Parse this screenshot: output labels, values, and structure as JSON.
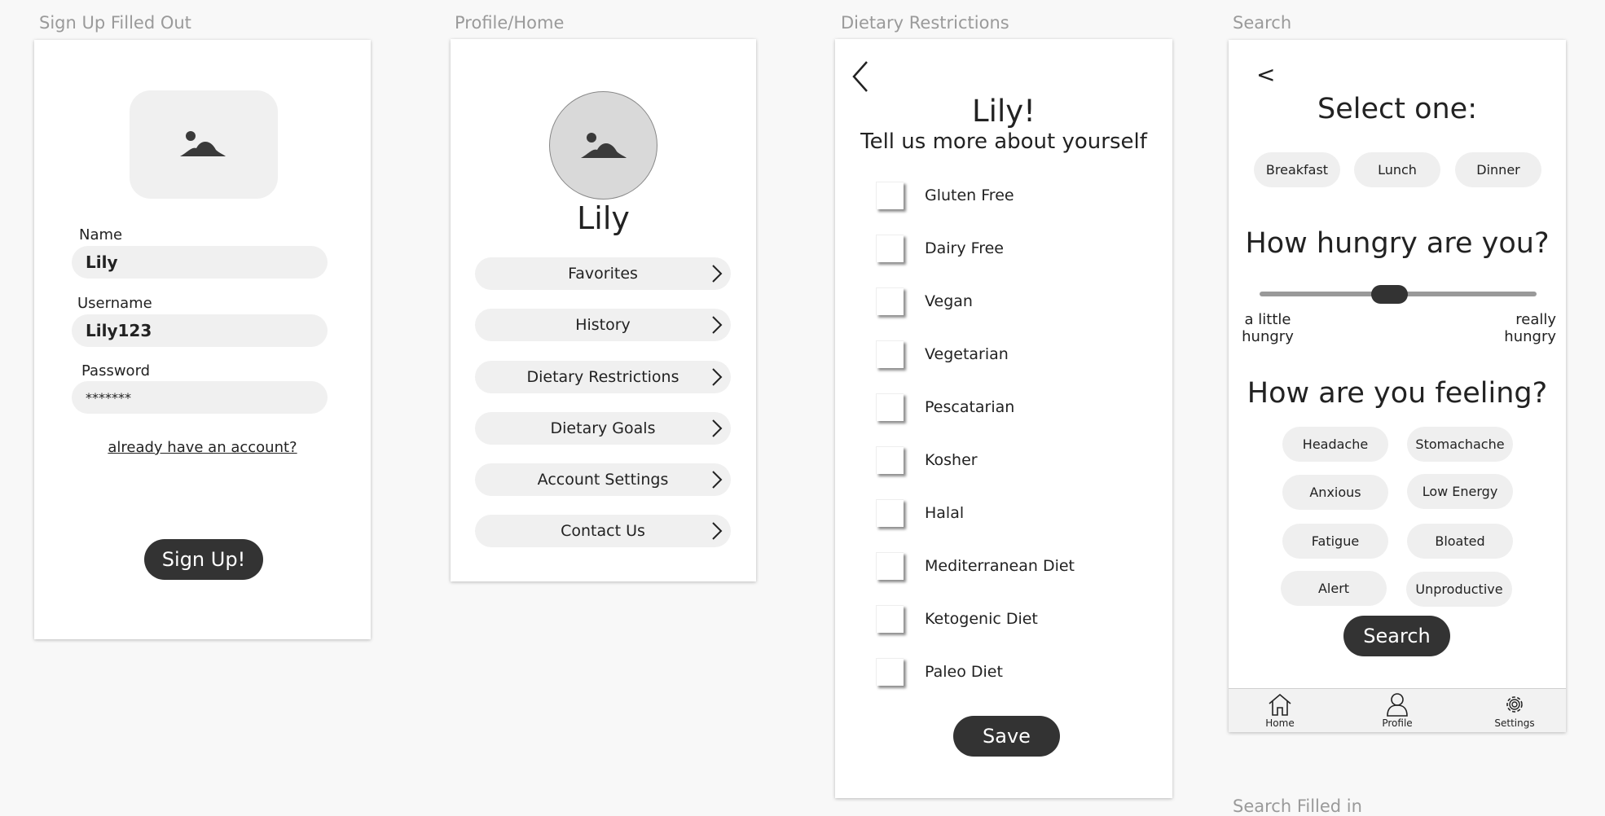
{
  "screens": {
    "signup": {
      "label": "Sign Up Filled Out",
      "name_label": "Name",
      "name_value": "Lily",
      "username_label": "Username",
      "username_value": "Lily123",
      "password_label": "Password",
      "password_value": "*******",
      "account_link": "already have an account?",
      "signup_button": "Sign Up!"
    },
    "profile": {
      "label": "Profile/Home",
      "user_name": "Lily",
      "menu": [
        {
          "label": "Favorites"
        },
        {
          "label": "History"
        },
        {
          "label": "Dietary Restrictions"
        },
        {
          "label": "Dietary Goals"
        },
        {
          "label": "Account Settings"
        },
        {
          "label": "Contact Us"
        }
      ]
    },
    "dietary": {
      "label": "Dietary Restrictions",
      "back_icon": "chevron-left-icon",
      "title": "Lily!",
      "subtitle": "Tell us more about yourself",
      "options": [
        {
          "label": "Gluten Free"
        },
        {
          "label": "Dairy Free"
        },
        {
          "label": "Vegan"
        },
        {
          "label": "Vegetarian"
        },
        {
          "label": "Pescatarian"
        },
        {
          "label": "Kosher"
        },
        {
          "label": "Halal"
        },
        {
          "label": "Mediterranean Diet"
        },
        {
          "label": "Ketogenic Diet"
        },
        {
          "label": "Paleo Diet"
        }
      ],
      "save_button": "Save"
    },
    "search": {
      "label": "Search",
      "back_label": "<",
      "select_title": "Select one:",
      "meals": [
        "Breakfast",
        "Lunch",
        "Dinner"
      ],
      "hungry_title": "How hungry are you?",
      "slider_value": 0.47,
      "slider_min_label_1": "a little",
      "slider_min_label_2": "hungry",
      "slider_max_label_1": "really",
      "slider_max_label_2": "hungry",
      "feeling_title": "How are you feeling?",
      "feelings": [
        "Headache",
        "Stomachache",
        "Anxious",
        "Low Energy",
        "Fatigue",
        "Bloated",
        "Alert",
        "Unproductive"
      ],
      "search_button": "Search",
      "nav": {
        "home": "Home",
        "profile": "Profile",
        "settings": "Settings"
      }
    },
    "partial_label": "Search Filled in"
  },
  "colors": {
    "background": "#f8f8f8",
    "dark_button": "#333333",
    "pill_fill": "#f0f0f0",
    "label_gray": "#9a9a9a"
  }
}
